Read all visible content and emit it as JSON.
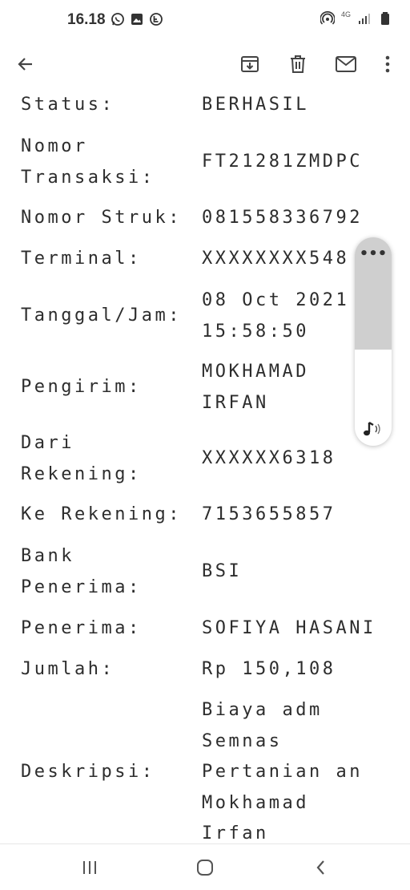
{
  "status_bar": {
    "time": "16.18",
    "left_icons": [
      "whatsapp-icon",
      "gallery-icon",
      "shop-icon"
    ],
    "right_icons": [
      "hotspot-icon",
      "4g-icon",
      "signal-icon",
      "battery-icon"
    ],
    "network": "4G"
  },
  "toolbar": {
    "icons": [
      "back-arrow-icon",
      "archive-icon",
      "trash-icon",
      "mail-icon",
      "more-vert-icon"
    ]
  },
  "transaction": {
    "rows": [
      {
        "label": "Status:",
        "value": "BERHASIL"
      },
      {
        "label": "Nomor\nTransaksi:",
        "value": "FT21281ZMDPC"
      },
      {
        "label": "Nomor Struk:",
        "value": "081558336792"
      },
      {
        "label": "Terminal:",
        "value": "XXXXXXXX548"
      },
      {
        "label": "Tanggal/Jam:",
        "value": "08 Oct 2021\n15:58:50"
      },
      {
        "label": "Pengirim:",
        "value": "MOKHAMAD\nIRFAN"
      },
      {
        "label": "Dari\nRekening:",
        "value": "XXXXXX6318"
      },
      {
        "label": "Ke Rekening:",
        "value": "7153655857"
      },
      {
        "label": "Bank\nPenerima:",
        "value": "BSI"
      },
      {
        "label": "Penerima:",
        "value": "SOFIYA HASANI"
      },
      {
        "label": "Jumlah:",
        "value": "Rp 150,108"
      },
      {
        "label": "Deskripsi:",
        "value": "Biaya adm\nSemnas\nPertanian an\nMokhamad\nIrfan"
      }
    ]
  },
  "widget": {
    "menu_label": "•••",
    "icons": [
      "music-note-icon"
    ]
  },
  "nav_bar": {
    "icons": [
      "recent-apps-icon",
      "home-icon",
      "back-icon"
    ]
  }
}
